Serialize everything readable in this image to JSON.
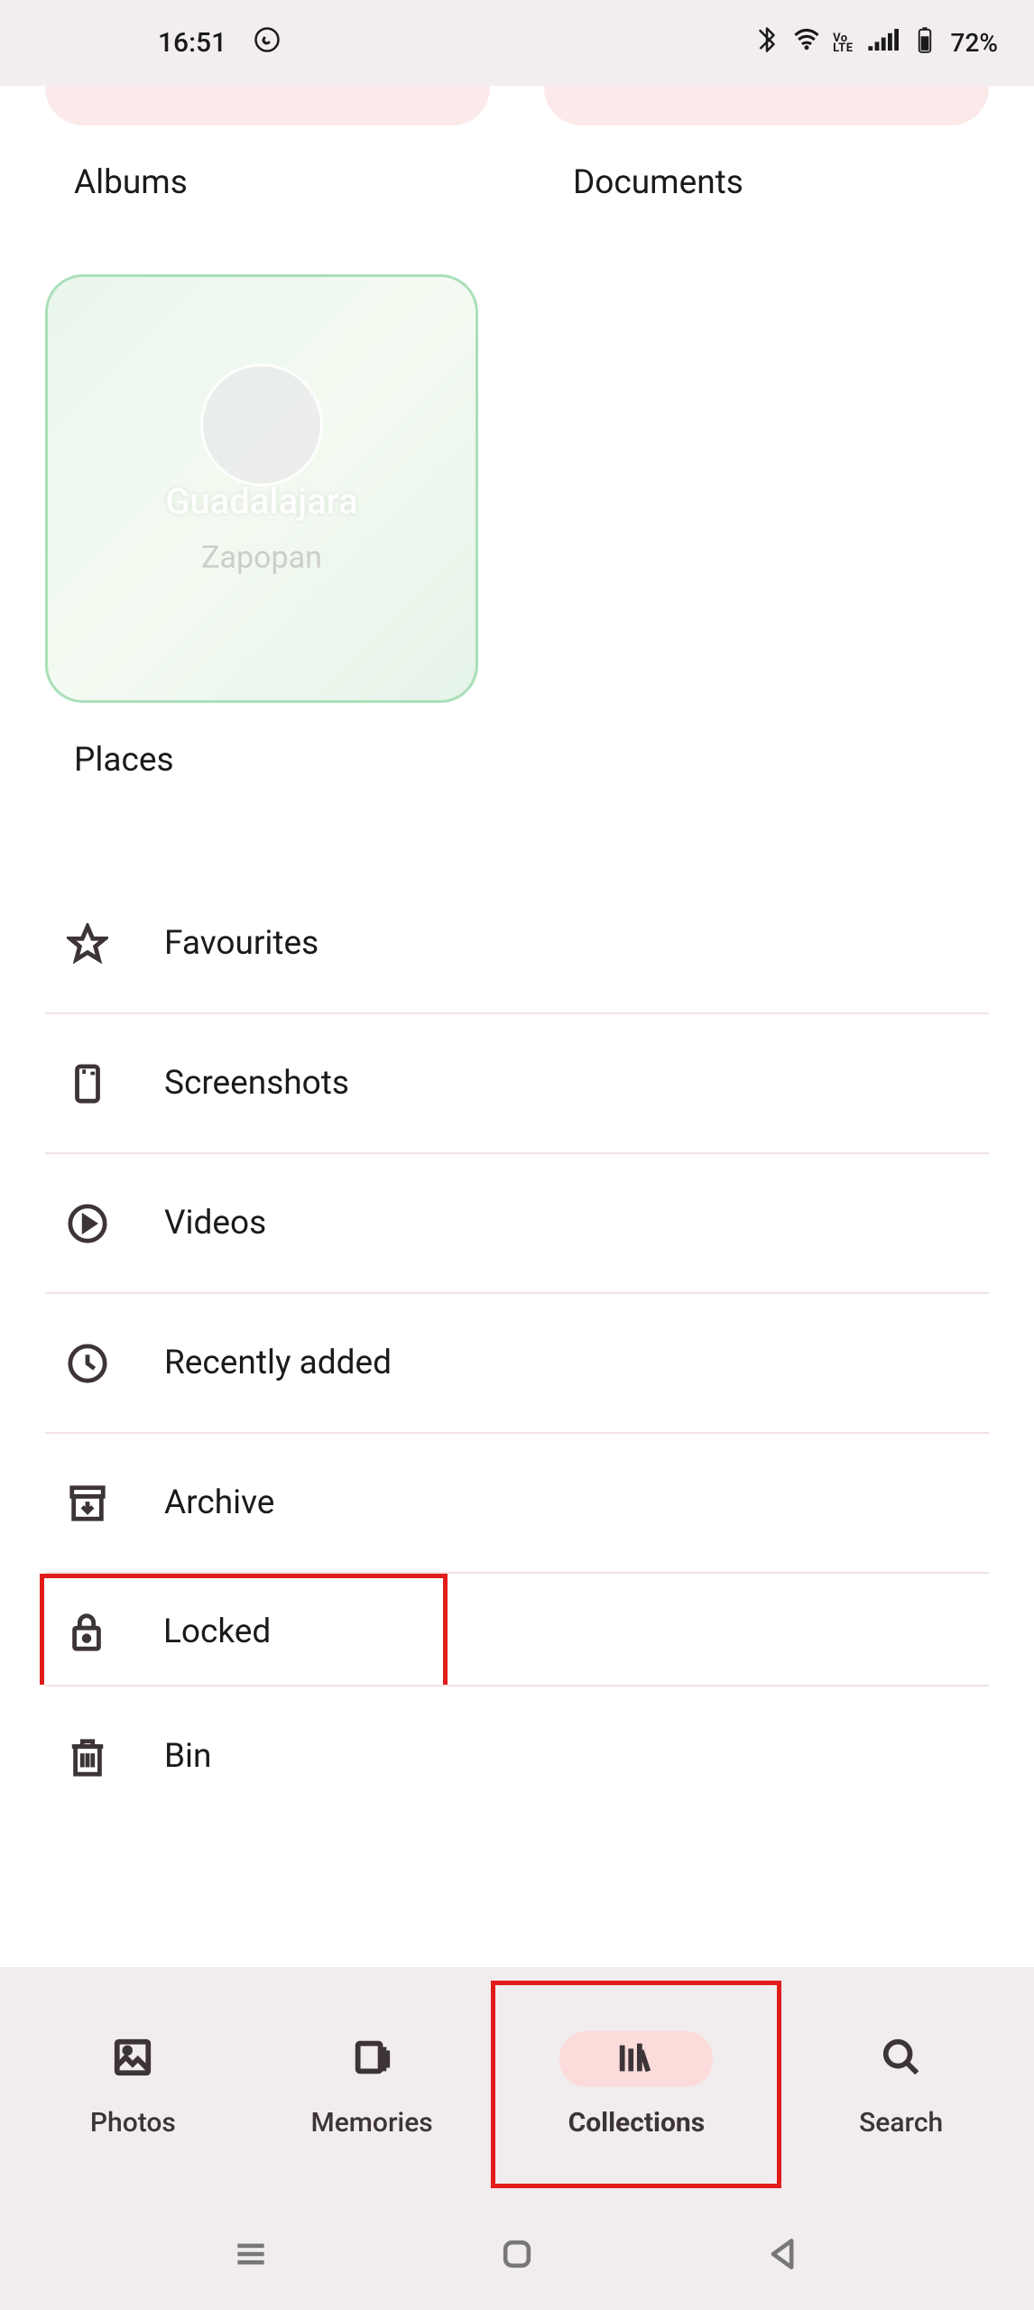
{
  "status_bar": {
    "time": "16:51",
    "battery_percent": "72%",
    "volte": "Vo",
    "lte": "LTE"
  },
  "tiles": {
    "albums": "Albums",
    "documents": "Documents",
    "places": "Places",
    "places_map_city": "Guadalajara",
    "places_map_area": "Zapopan"
  },
  "list": {
    "favourites": "Favourites",
    "screenshots": "Screenshots",
    "videos": "Videos",
    "recently_added": "Recently added",
    "archive": "Archive",
    "locked": "Locked",
    "bin": "Bin"
  },
  "nav": {
    "photos": "Photos",
    "memories": "Memories",
    "collections": "Collections",
    "search": "Search"
  }
}
